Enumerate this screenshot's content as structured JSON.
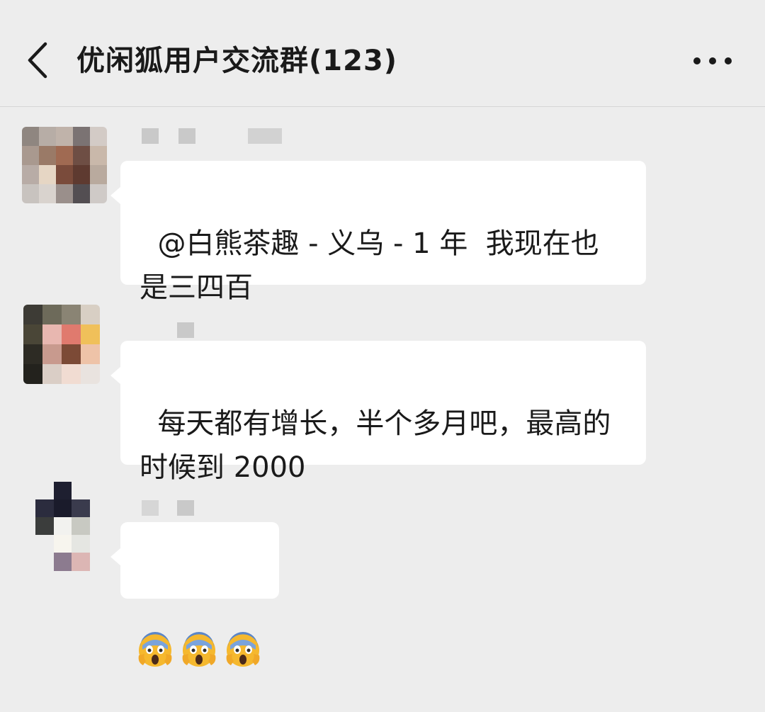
{
  "header": {
    "back_icon": "chevron-left-icon",
    "title": "优闲狐用户交流群(123)",
    "more_icon": "more-horizontal-icon"
  },
  "messages": [
    {
      "text": "@白熊茶趣 - 义乌 - 1 年  我现在也是三四百"
    },
    {
      "text": "每天都有增长，半个多月吧，最高的时候到 2000"
    },
    {
      "emoji": [
        "face-screaming-in-fear",
        "face-screaming-in-fear",
        "face-screaming-in-fear"
      ]
    }
  ],
  "colors": {
    "background": "#ededed",
    "bubble": "#ffffff",
    "text": "#1a1a1a"
  }
}
